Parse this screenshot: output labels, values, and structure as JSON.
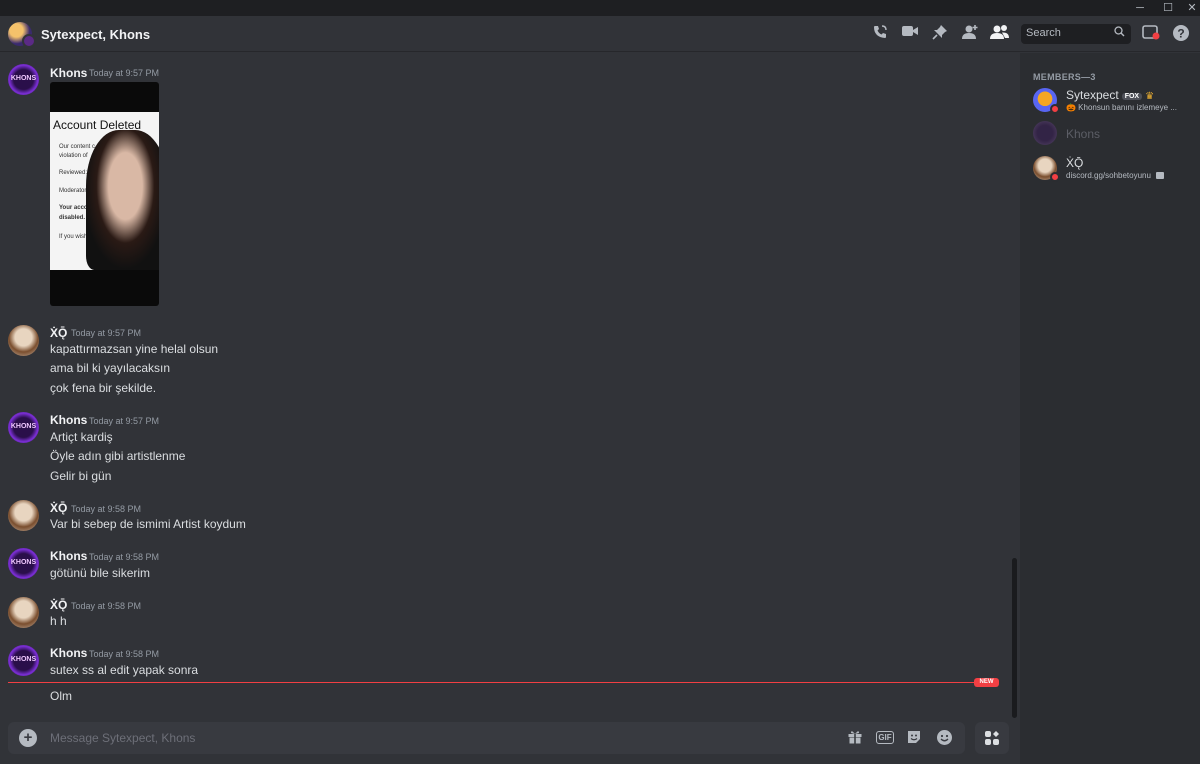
{
  "window": {
    "minimize": "─",
    "maximize": "☐",
    "close": "✕"
  },
  "header": {
    "title": "Sytexpect, Khons",
    "search_placeholder": "Search",
    "icons": [
      "phone-call-icon",
      "video-call-icon",
      "pin-icon",
      "add-friend-icon",
      "member-list-icon",
      "inbox-icon",
      "help-icon"
    ]
  },
  "messages": [
    {
      "author": "Khons",
      "time": "Today at 9:57 PM",
      "lines": [],
      "has_image": true
    },
    {
      "author": "ẊǬ",
      "time": "Today at 9:57 PM",
      "lines": [
        "kapattırmazsan yine helal olsun",
        "ama bil ki yayılacaksın",
        "çok fena bir şekilde."
      ]
    },
    {
      "author": "Khons",
      "time": "Today at 9:57 PM",
      "lines": [
        "Artiçt kardiş",
        "Öyle adın gibi artistlenme",
        "Gelir bi gün"
      ]
    },
    {
      "author": "ẊǬ",
      "time": "Today at 9:58 PM",
      "lines": [
        "Var bi sebep de ismimi Artist koydum"
      ]
    },
    {
      "author": "Khons",
      "time": "Today at 9:58 PM",
      "lines": [
        "götünü bile sikerim"
      ]
    },
    {
      "author": "ẊǬ",
      "time": "Today at 9:58 PM",
      "lines": [
        "h h"
      ]
    },
    {
      "author": "Khons",
      "time": "Today at 9:58 PM",
      "lines": [
        "sutex ss al edit yapak sonra",
        "Olm"
      ]
    }
  ],
  "image_embed": {
    "title": "Account Deleted",
    "lines": [
      "Our content c",
      "violation of",
      "Reviewed:",
      "Moderator N",
      "Your accou",
      "disabled.",
      "If you wish t"
    ]
  },
  "avatar_label": "KHONS",
  "new_badge": "NEW",
  "composer": {
    "placeholder": "Message Sytexpect, Khons",
    "gif_label": "GIF",
    "icons": [
      "add-attachment-icon",
      "gift-icon",
      "gif-icon",
      "sticker-icon",
      "emoji-icon",
      "apps-icon"
    ]
  },
  "members": {
    "heading": "MEMBERS—3",
    "list": [
      {
        "name": "Sytexpect",
        "tag": "FOX",
        "status_text": "🎃 Khonsun banını izlemeye ...",
        "status": "dnd"
      },
      {
        "name": "Khons",
        "status_text": "",
        "status": "offline"
      },
      {
        "name": "ẊǬ",
        "status_text": "discord.gg/sohbetoyunu",
        "status": "dnd"
      }
    ]
  },
  "colors": {
    "background": "#313338",
    "sidebar": "#2b2d31",
    "accent_red": "#f23f43",
    "text": "#dbdee1"
  }
}
